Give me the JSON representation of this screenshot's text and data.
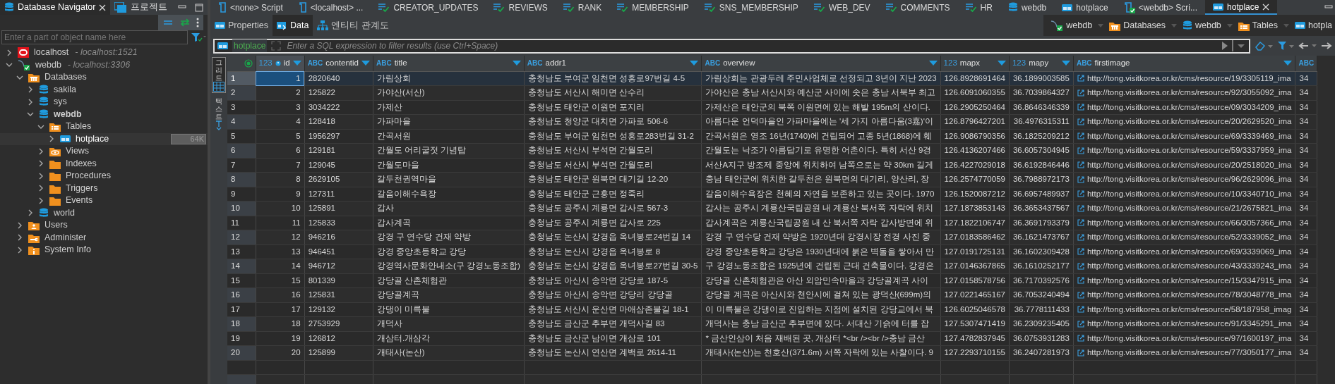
{
  "navigator": {
    "tabs": [
      {
        "label": "Database Navigator",
        "kind": "database",
        "selected": true,
        "closable": true
      },
      {
        "label": "프로젝트",
        "kind": "project",
        "selected": false,
        "closable": false
      }
    ],
    "search": {
      "placeholder": "Enter a part of object name here"
    },
    "tree": [
      {
        "label": "localhost",
        "detail": "- localhost:1521",
        "kind": "oracle",
        "expanded": false,
        "selected": false
      },
      {
        "label": "webdb",
        "detail": "- localhost:3306",
        "kind": "mysql",
        "expanded": true,
        "selected": false,
        "children": [
          {
            "label": "Databases",
            "kind": "folder-databases",
            "expanded": true,
            "selected": false,
            "children": [
              {
                "label": "sakila",
                "kind": "database",
                "expanded": false,
                "selected": false,
                "active": false
              },
              {
                "label": "sys",
                "kind": "database",
                "expanded": false,
                "selected": false,
                "active": false
              },
              {
                "label": "webdb",
                "kind": "database",
                "expanded": true,
                "selected": false,
                "active": true,
                "children": [
                  {
                    "label": "Tables",
                    "kind": "folder-tables",
                    "expanded": true,
                    "selected": false,
                    "children": [
                      {
                        "label": "hotplace",
                        "kind": "table",
                        "expanded": false,
                        "selected": true,
                        "badge": "64K"
                      }
                    ]
                  },
                  {
                    "label": "Views",
                    "kind": "folder-views",
                    "expanded": false,
                    "selected": false
                  },
                  {
                    "label": "Indexes",
                    "kind": "folder",
                    "expanded": false,
                    "selected": false
                  },
                  {
                    "label": "Procedures",
                    "kind": "folder",
                    "expanded": false,
                    "selected": false
                  },
                  {
                    "label": "Triggers",
                    "kind": "folder",
                    "expanded": false,
                    "selected": false
                  },
                  {
                    "label": "Events",
                    "kind": "folder",
                    "expanded": false,
                    "selected": false
                  }
                ]
              },
              {
                "label": "world",
                "kind": "database",
                "expanded": false,
                "selected": false,
                "active": false
              }
            ]
          },
          {
            "label": "Users",
            "kind": "folder-users",
            "expanded": false,
            "selected": false
          },
          {
            "label": "Administer",
            "kind": "folder-admin",
            "expanded": false,
            "selected": false
          },
          {
            "label": "System Info",
            "kind": "folder-info",
            "expanded": false,
            "selected": false
          }
        ]
      }
    ]
  },
  "editor_tabs": [
    {
      "label": "<none> Script",
      "kind": "script",
      "selected": false
    },
    {
      "label": "<localhost> ...",
      "kind": "script",
      "selected": false
    },
    {
      "label": "CREATOR_UPDATES",
      "kind": "query",
      "selected": false
    },
    {
      "label": "REVIEWS",
      "kind": "query",
      "selected": false
    },
    {
      "label": "RANK",
      "kind": "query",
      "selected": false
    },
    {
      "label": "MEMBERSHIP",
      "kind": "query",
      "selected": false
    },
    {
      "label": "SNS_MEMBERSHIP",
      "kind": "query",
      "selected": false
    },
    {
      "label": "WEB_DEV",
      "kind": "query",
      "selected": false
    },
    {
      "label": "COMMENTS",
      "kind": "query",
      "selected": false
    },
    {
      "label": "HR",
      "kind": "query",
      "selected": false
    },
    {
      "label": "webdb",
      "kind": "database",
      "selected": false
    },
    {
      "label": "hotplace",
      "kind": "table",
      "selected": false
    },
    {
      "label": "<webdb> Scri...",
      "kind": "script-connected",
      "selected": false
    },
    {
      "label": "hotplace",
      "kind": "table",
      "selected": true
    }
  ],
  "sub_tabs": [
    {
      "label": "Properties",
      "kind": "table",
      "selected": false
    },
    {
      "label": "Data",
      "kind": "data",
      "selected": true
    },
    {
      "label": "엔티티 관계도",
      "kind": "diagram",
      "selected": false
    }
  ],
  "breadcrumb": [
    {
      "label": "webdb",
      "kind": "mysql"
    },
    {
      "label": "Databases",
      "kind": "folder-databases"
    },
    {
      "label": "webdb",
      "kind": "database"
    },
    {
      "label": "Tables",
      "kind": "folder-tables"
    },
    {
      "label": "hotpla",
      "kind": "table"
    }
  ],
  "filter": {
    "table": "hotplace",
    "placeholder": "Enter a SQL expression to filter results (use Ctrl+Space)"
  },
  "view_switcher": [
    {
      "label": "그리드",
      "kind": "grid",
      "selected": true
    },
    {
      "label": "텍스트",
      "kind": "text",
      "selected": false
    }
  ],
  "table": {
    "columns": [
      {
        "name": "id",
        "type": "123",
        "kind": "number",
        "key": true
      },
      {
        "name": "contentid",
        "type": "ABC",
        "kind": "text",
        "key": false
      },
      {
        "name": "title",
        "type": "ABC",
        "kind": "text",
        "key": false
      },
      {
        "name": "addr1",
        "type": "ABC",
        "kind": "text",
        "key": false
      },
      {
        "name": "overview",
        "type": "ABC",
        "kind": "text",
        "key": false
      },
      {
        "name": "mapx",
        "type": "123",
        "kind": "number",
        "key": false
      },
      {
        "name": "mapy",
        "type": "123",
        "kind": "number",
        "key": false
      },
      {
        "name": "firstimage",
        "type": "ABC",
        "kind": "link",
        "key": false
      },
      {
        "type": "ABC",
        "kind": "text",
        "key": false
      }
    ],
    "rows": [
      {
        "number": "1",
        "selected": true,
        "cells": [
          "1",
          "2820640",
          "가림상회",
          "충청남도 부여군 임천면 성흥로97번길 4-5",
          "가림상회는 관광두레 주민사업체로 선정되고 3년이 지난 2023",
          "126.8928691464",
          "36.1899003585",
          "http://tong.visitkorea.or.kr/cms/resource/19/3305119_ima",
          "34"
        ]
      },
      {
        "number": "2",
        "selected": false,
        "cells": [
          "2",
          "125822",
          "가야산(서산)",
          "충청남도 서산시 해미면 산수리",
          "가야산은 충남 서산시와 예산군 사이에 솟은 충남 서북부 최고",
          "126.6091060355",
          "36.7039864327",
          "http://tong.visitkorea.or.kr/cms/resource/92/3055092_ima",
          "34"
        ]
      },
      {
        "number": "3",
        "selected": false,
        "cells": [
          "3",
          "3034222",
          "가제산",
          "충청남도 태안군 이원면 포지리",
          "가제산은 태안군의 북쪽 이원면에 있는 해발 195m의 산이다.",
          "126.2905250464",
          "36.8646346339",
          "http://tong.visitkorea.or.kr/cms/resource/09/3034209_ima",
          "34"
        ]
      },
      {
        "number": "4",
        "selected": false,
        "cells": [
          "4",
          "128418",
          "가파마을",
          "충청남도 청양군 대치면 가파로 506-6",
          "아름다운 언덕마을인 가파마을에는 '세 가지 아름다움(3嘉)'이",
          "126.8796427201",
          "36.4976315311",
          "http://tong.visitkorea.or.kr/cms/resource/20/2629520_ima",
          "34"
        ]
      },
      {
        "number": "5",
        "selected": false,
        "cells": [
          "5",
          "1956297",
          "간곡서원",
          "충청남도 부여군 임천면 성흥로283번길 31-2",
          "간곡서원은 영조 16년(1740)에 건립되어 고종 5년(1868)에 훼",
          "126.9086790356",
          "36.1825209212",
          "http://tong.visitkorea.or.kr/cms/resource/69/3339469_ima",
          "34"
        ]
      },
      {
        "number": "6",
        "selected": false,
        "cells": [
          "6",
          "129181",
          "간월도 어리굴젓 기념탑",
          "충청남도 서산시 부석면 간월도리",
          "간월도는 낙조가 아름답기로 유명한 어촌이다. 특히 서산 9경",
          "126.4136207466",
          "36.6057304945",
          "http://tong.visitkorea.or.kr/cms/resource/59/3337959_ima",
          "34"
        ]
      },
      {
        "number": "7",
        "selected": false,
        "cells": [
          "7",
          "129045",
          "간월도마을",
          "충청남도 서산시 부석면 간월도리",
          "서산A지구 방조제 중앙에 위치하여 남쪽으로는 약 30km 길게",
          "126.4227029018",
          "36.6192846446",
          "http://tong.visitkorea.or.kr/cms/resource/20/2518020_ima",
          "34"
        ]
      },
      {
        "number": "8",
        "selected": false,
        "cells": [
          "8",
          "2629105",
          "갈두천권역마을",
          "충청남도 태안군 원북면 대기길 12-20",
          "충남 태안군에 위치한 갈두천은 원북면의 대기리, 양산리, 장",
          "126.2574770059",
          "36.7988972173",
          "http://tong.visitkorea.or.kr/cms/resource/96/2629096_ima",
          "34"
        ]
      },
      {
        "number": "9",
        "selected": false,
        "cells": [
          "9",
          "127311",
          "갈음이해수욕장",
          "충청남도 태안군 근흥면 정죽리",
          "갈음이해수욕장은 천혜의 자연을 보존하고 있는 곳이다. 1970",
          "126.1520087212",
          "36.6957489937",
          "http://tong.visitkorea.or.kr/cms/resource/10/3340710_ima",
          "34"
        ]
      },
      {
        "number": "10",
        "selected": false,
        "cells": [
          "10",
          "125891",
          "갑사",
          "충청남도 공주시 계룡면 갑사로 567-3",
          "갑사는 공주시 계룡산국립공원 내 계룡산 북서쪽 자락에 위치",
          "127.1873853143",
          "36.3653437567",
          "http://tong.visitkorea.or.kr/cms/resource/21/2675821_ima",
          "34"
        ]
      },
      {
        "number": "11",
        "selected": false,
        "cells": [
          "11",
          "125833",
          "갑사계곡",
          "충청남도 공주시 계룡면 갑사로 225",
          "갑사계곡은 계룡산국립공원 내 산 북서쪽 자락 갑사방면에 위",
          "127.1822106747",
          "36.3691793379",
          "http://tong.visitkorea.or.kr/cms/resource/66/3057366_ima",
          "34"
        ]
      },
      {
        "number": "12",
        "selected": false,
        "cells": [
          "12",
          "946216",
          "강경 구 연수당 건재 약방",
          "충청남도 논산시 강경읍 옥녀봉로24번길 14",
          "강경 구 연수당 건재 약방은 1920년대 강경시장 전경 사진 중",
          "127.0183586462",
          "36.1621473767",
          "http://tong.visitkorea.or.kr/cms/resource/52/3339052_ima",
          "34"
        ]
      },
      {
        "number": "13",
        "selected": false,
        "cells": [
          "13",
          "946451",
          "강경 중앙초등학교 강당",
          "충청남도 논산시 강경읍 옥녀봉로 8",
          "강경 중앙초등학교 강당은 1930년대에 붉은 벽돌을 쌓아서 만",
          "127.0191725131",
          "36.1602309428",
          "http://tong.visitkorea.or.kr/cms/resource/69/3339069_ima",
          "34"
        ]
      },
      {
        "number": "14",
        "selected": false,
        "cells": [
          "14",
          "946712",
          "강경역사문화안내소(구 강경노동조합)",
          "충청남도 논산시 강경읍 옥녀봉로27번길 30-5",
          "구 강경노동조합은 1925년에 건립된 근대 건축물이다. 강경은",
          "127.0146367865",
          "36.1610252177",
          "http://tong.visitkorea.or.kr/cms/resource/43/3339243_ima",
          "34"
        ]
      },
      {
        "number": "15",
        "selected": false,
        "cells": [
          "15",
          "801339",
          "강당골 산촌체험관",
          "충청남도 아산시 송악면 강당로 187-5",
          "강당골 산촌체험관은 아산 외암민속마을과 강당골계곡 사이",
          "127.0158578756",
          "36.7170392576",
          "http://tong.visitkorea.or.kr/cms/resource/15/3347915_ima",
          "34"
        ]
      },
      {
        "number": "16",
        "selected": false,
        "cells": [
          "16",
          "125831",
          "강당골계곡",
          "충청남도 아산시 송악면 강당리 강당골",
          "강당골 계곡은 아산시와 천안시에 걸쳐 있는 광덕산(699m)의",
          "127.0221465167",
          "36.7053240494",
          "http://tong.visitkorea.or.kr/cms/resource/78/3048778_ima",
          "34"
        ]
      },
      {
        "number": "17",
        "selected": false,
        "cells": [
          "17",
          "129132",
          "강댕이 미륵불",
          "충청남도 서산시 운산면 마애삼존불길 18-1",
          "이 미륵불은 강댕이로 진입하는 지점에 설치된 강당교에서 북",
          "126.6025046578",
          "36.7778111433",
          "http://tong.visitkorea.or.kr/cms/resource/58/187958_imag",
          "34"
        ]
      },
      {
        "number": "18",
        "selected": false,
        "cells": [
          "18",
          "2753929",
          "개덕사",
          "충청남도 금산군 추부면 개덕사길 83",
          "개덕사는 충남 금산군 추부면에 있다. 서대산 기슭에 터를 잡",
          "127.5307471419",
          "36.2309235405",
          "http://tong.visitkorea.or.kr/cms/resource/91/3345291_ima",
          "34"
        ]
      },
      {
        "number": "19",
        "selected": false,
        "cells": [
          "19",
          "126812",
          "개삼터.개삼각",
          "충청남도 금산군 남이면 개삼로 101",
          "* 금산인삼이 처음 재배된 곳, 개삼터 *<br /><br />충남 금산",
          "127.4782837945",
          "36.0753931283",
          "http://tong.visitkorea.or.kr/cms/resource/97/1600197_ima",
          "34"
        ]
      },
      {
        "number": "20",
        "selected": false,
        "cells": [
          "20",
          "125899",
          "개태사(논산)",
          "충청남도 논산시 연산면 계백로 2614-11",
          "개태사(논산)는 천호산(371.6m) 서쪽 자락에 있는 사찰이다. 9",
          "127.2293710155",
          "36.2407281973",
          "http://tong.visitkorea.or.kr/cms/resource/77/3050177_ima",
          "34"
        ]
      }
    ]
  }
}
